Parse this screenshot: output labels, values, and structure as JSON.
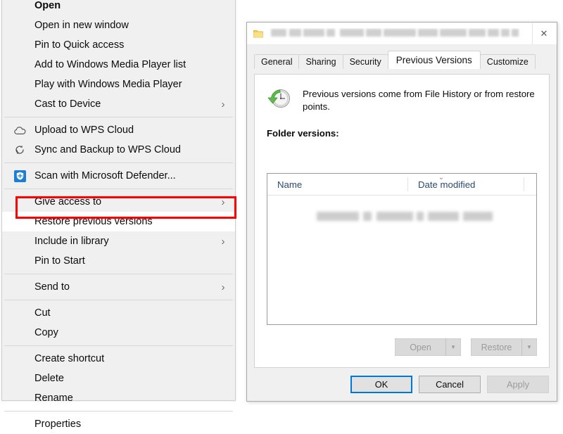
{
  "context_menu": {
    "name": "file-explorer-context-menu",
    "groups": [
      {
        "items": [
          {
            "label": "Open",
            "bold": true,
            "icon": null,
            "submenu": false
          },
          {
            "label": "Open in new window",
            "bold": false,
            "icon": null,
            "submenu": false
          },
          {
            "label": "Pin to Quick access",
            "bold": false,
            "icon": null,
            "submenu": false
          },
          {
            "label": "Add to Windows Media Player list",
            "bold": false,
            "icon": null,
            "submenu": false
          },
          {
            "label": "Play with Windows Media Player",
            "bold": false,
            "icon": null,
            "submenu": false
          },
          {
            "label": "Cast to Device",
            "bold": false,
            "icon": null,
            "submenu": true
          }
        ]
      },
      {
        "items": [
          {
            "label": "Upload to WPS Cloud",
            "bold": false,
            "icon": "cloud-icon",
            "submenu": false
          },
          {
            "label": "Sync and Backup to WPS Cloud",
            "bold": false,
            "icon": "sync-icon",
            "submenu": false
          }
        ]
      },
      {
        "items": [
          {
            "label": "Scan with Microsoft Defender...",
            "bold": false,
            "icon": "shield-icon",
            "submenu": false
          }
        ]
      },
      {
        "items": [
          {
            "label": "Give access to",
            "bold": false,
            "icon": null,
            "submenu": true
          },
          {
            "label": "Restore previous versions",
            "bold": false,
            "icon": null,
            "submenu": false,
            "highlighted": true
          },
          {
            "label": "Include in library",
            "bold": false,
            "icon": null,
            "submenu": true
          },
          {
            "label": "Pin to Start",
            "bold": false,
            "icon": null,
            "submenu": false
          }
        ]
      },
      {
        "items": [
          {
            "label": "Send to",
            "bold": false,
            "icon": null,
            "submenu": true
          }
        ]
      },
      {
        "items": [
          {
            "label": "Cut",
            "bold": false,
            "icon": null,
            "submenu": false
          },
          {
            "label": "Copy",
            "bold": false,
            "icon": null,
            "submenu": false
          }
        ]
      },
      {
        "items": [
          {
            "label": "Create shortcut",
            "bold": false,
            "icon": null,
            "submenu": false
          },
          {
            "label": "Delete",
            "bold": false,
            "icon": null,
            "submenu": false
          },
          {
            "label": "Rename",
            "bold": false,
            "icon": null,
            "submenu": false
          }
        ]
      },
      {
        "items": [
          {
            "label": "Properties",
            "bold": false,
            "icon": null,
            "submenu": false
          }
        ]
      }
    ],
    "highlight_color": "#ff0000",
    "submenu_arrow": "›"
  },
  "dialog": {
    "title": "",
    "title_redacted": true,
    "close_label": "✕",
    "tabs": [
      {
        "label": "General",
        "active": false
      },
      {
        "label": "Sharing",
        "active": false
      },
      {
        "label": "Security",
        "active": false
      },
      {
        "label": "Previous Versions",
        "active": true
      },
      {
        "label": "Customize",
        "active": false
      }
    ],
    "info_text": "Previous versions come from File History or from restore points.",
    "section_label": "Folder versions:",
    "listview": {
      "columns": [
        "Name",
        "Date modified"
      ],
      "sort_indicator": "⌄",
      "rows": [
        {
          "redacted": true
        }
      ]
    },
    "split_buttons": [
      {
        "label": "Open",
        "enabled": false,
        "caret": "▼"
      },
      {
        "label": "Restore",
        "enabled": false,
        "caret": "▼"
      }
    ],
    "footer_buttons": [
      {
        "label": "OK",
        "state": "default-focused"
      },
      {
        "label": "Cancel",
        "state": "normal"
      },
      {
        "label": "Apply",
        "state": "disabled"
      }
    ],
    "accent_color": "#0078d7"
  }
}
